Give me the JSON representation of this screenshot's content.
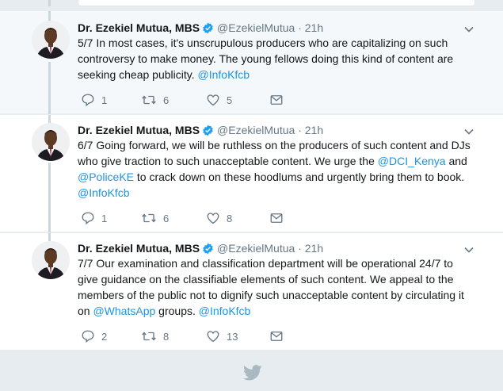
{
  "tweets": [
    {
      "name": "Dr. Ezekiel Mutua, MBS",
      "handle": "@EzekielMutua",
      "dot": "·",
      "time": "21h",
      "parts": [
        "5/7 In most cases, it's unscrupulous producers who are capitalizing on such",
        "controversy to make money. The young fellows doing this kind of content are",
        "seeking cheap publicity. ",
        "@InfoKfcb"
      ],
      "replies": "1",
      "retweets": "6",
      "likes": "5"
    },
    {
      "name": "Dr. Ezekiel Mutua, MBS",
      "handle": "@EzekielMutua",
      "dot": "·",
      "time": "21h",
      "parts": [
        "6/7 Going forward, we will be ruthless on the producers of such content and DJs",
        "who give traction to such unacceptable content. We urge the ",
        "@DCI_Kenya",
        " and",
        "@PoliceKE",
        " to crack down on these hoodlums and urgently bring them to book.",
        "@InfoKfcb"
      ],
      "replies": "1",
      "retweets": "6",
      "likes": "8"
    },
    {
      "name": "Dr. Ezekiel Mutua, MBS",
      "handle": "@EzekielMutua",
      "dot": "·",
      "time": "21h",
      "parts": [
        "7/7 Our examination and classification department will be operational 24/7 to",
        "give guidance on the classifiable elements of such content. We appeal to the",
        "members of the public not to dignify such unacceptable content by circulating it",
        "on ",
        "@WhatsApp",
        " groups. ",
        "@InfoKfcb"
      ],
      "replies": "2",
      "retweets": "8",
      "likes": "13"
    }
  ],
  "icons": {
    "reply": "reply-icon",
    "retweet": "retweet-icon",
    "like": "like-icon",
    "message": "direct-message-icon",
    "verified": "verified-badge-icon",
    "caret": "chevron-down-icon",
    "bird": "twitter-bird-icon"
  },
  "colors": {
    "link": "#1b95e0",
    "muted": "#657786",
    "verified": "#1da1f2",
    "background": "#e6ecf0"
  }
}
